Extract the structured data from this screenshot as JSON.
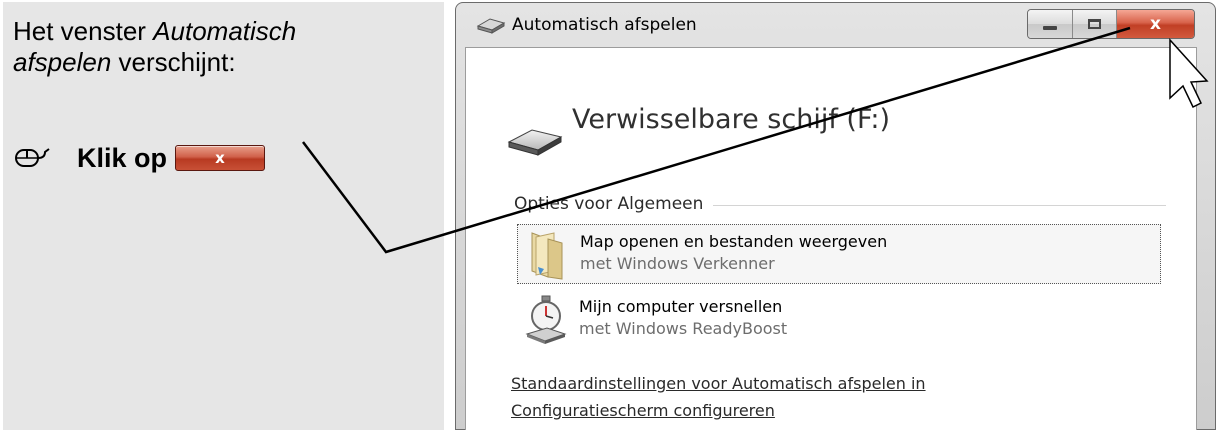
{
  "instruction": {
    "line1_plain": "Het venster ",
    "line1_italic": "Automatisch",
    "line2_italic": "afspelen",
    "line2_plain": " verschijnt:",
    "step_label": "Klik op",
    "step_button_glyph": "x",
    "step_icon": "mouse-icon"
  },
  "window": {
    "title": "Automatisch afspelen",
    "close_glyph": "x",
    "device_name": "Verwisselbare schijf (F:)",
    "group_label": "Opties voor Algemeen",
    "options": [
      {
        "title": "Map openen en bestanden weergeven",
        "subtitle": "met Windows Verkenner",
        "icon": "folder-icon"
      },
      {
        "title": "Mijn computer versnellen",
        "subtitle": "met Windows ReadyBoost",
        "icon": "stopwatch-icon"
      }
    ],
    "settings_link_line1": "Standaardinstellingen voor Automatisch afspelen in",
    "settings_link_line2": "Configuratiescherm configureren"
  },
  "colors": {
    "panel_bg": "#e6e6e6",
    "close_button_red": "#c13f25",
    "window_frame": "#cdcdcd"
  }
}
